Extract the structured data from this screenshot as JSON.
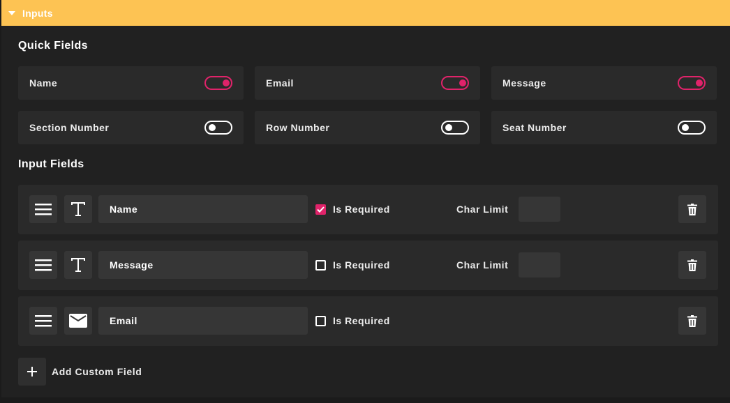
{
  "header": {
    "title": "Inputs",
    "accent": "#fdc353"
  },
  "quick_fields": {
    "title": "Quick Fields",
    "items": [
      {
        "label": "Name",
        "enabled": true
      },
      {
        "label": "Email",
        "enabled": true
      },
      {
        "label": "Message",
        "enabled": true
      },
      {
        "label": "Section Number",
        "enabled": false
      },
      {
        "label": "Row Number",
        "enabled": false
      },
      {
        "label": "Seat Number",
        "enabled": false
      }
    ]
  },
  "input_fields": {
    "title": "Input Fields",
    "rows": [
      {
        "type_icon": "text-icon",
        "value": "Name",
        "required": true,
        "required_label": "Is Required",
        "char_limit_label": "Char Limit",
        "char_limit_value": "",
        "has_char_limit": true
      },
      {
        "type_icon": "text-icon",
        "value": "Message",
        "required": false,
        "required_label": "Is Required",
        "char_limit_label": "Char Limit",
        "char_limit_value": "",
        "has_char_limit": true
      },
      {
        "type_icon": "mail-icon",
        "value": "Email",
        "required": false,
        "required_label": "Is Required",
        "has_char_limit": false
      }
    ]
  },
  "add_field": {
    "label": "Add Custom Field"
  },
  "colors": {
    "toggle_on": "#e0236a",
    "checkbox_checked": "#e0236a",
    "panel_bg": "#212121",
    "card_bg": "#2a2a2a"
  }
}
